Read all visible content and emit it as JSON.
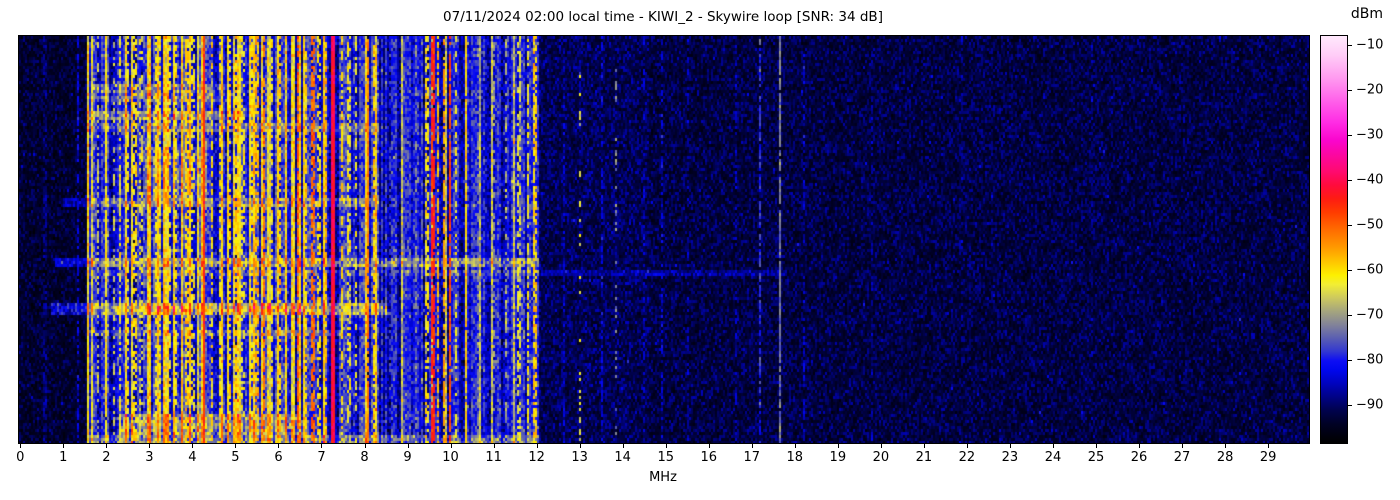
{
  "chart_data": {
    "type": "heatmap",
    "title": "07/11/2024 02:00 local time - KIWI_2 - Skywire loop [SNR: 34 dB]",
    "xlabel": "MHz",
    "x_range": [
      -0.03,
      29.95
    ],
    "x_ticks": [
      0,
      1,
      2,
      3,
      4,
      5,
      6,
      7,
      8,
      9,
      10,
      11,
      12,
      13,
      14,
      15,
      16,
      17,
      18,
      19,
      20,
      21,
      22,
      23,
      24,
      25,
      26,
      27,
      28,
      29
    ],
    "grid": false,
    "colorbar": {
      "label": "dBm",
      "vmin": -98.3,
      "vmax": -7.8,
      "ticks": [
        {
          "v": -10,
          "label": "−10"
        },
        {
          "v": -20,
          "label": "−20"
        },
        {
          "v": -30,
          "label": "−30"
        },
        {
          "v": -40,
          "label": "−40"
        },
        {
          "v": -50,
          "label": "−50"
        },
        {
          "v": -60,
          "label": "−60"
        },
        {
          "v": -70,
          "label": "−70"
        },
        {
          "v": -80,
          "label": "−80"
        },
        {
          "v": -90,
          "label": "−90"
        }
      ],
      "stops": [
        [
          -98.3,
          "#000000"
        ],
        [
          -97,
          "#00000a"
        ],
        [
          -94,
          "#000125"
        ],
        [
          -91,
          "#00024e"
        ],
        [
          -88,
          "#000287"
        ],
        [
          -85,
          "#0003bf"
        ],
        [
          -82,
          "#0007ee"
        ],
        [
          -80,
          "#0d0ef4"
        ],
        [
          -78,
          "#3136d2"
        ],
        [
          -75,
          "#5a5eb2"
        ],
        [
          -72,
          "#828399"
        ],
        [
          -69,
          "#a5a57e"
        ],
        [
          -66,
          "#cdc95e"
        ],
        [
          -63,
          "#f2ee33"
        ],
        [
          -61,
          "#fdf000"
        ],
        [
          -58,
          "#ffc600"
        ],
        [
          -55,
          "#ff9c00"
        ],
        [
          -51,
          "#ff6d00"
        ],
        [
          -47,
          "#ff3c00"
        ],
        [
          -44,
          "#fe1c12"
        ],
        [
          -41,
          "#ff0b3c"
        ],
        [
          -38,
          "#ff0a6e"
        ],
        [
          -34,
          "#fb07a4"
        ],
        [
          -31,
          "#fa05cd"
        ],
        [
          -27,
          "#ff2ce4"
        ],
        [
          -22,
          "#ff63ea"
        ],
        [
          -17,
          "#ff9cf0"
        ],
        [
          -12,
          "#ffcdf7"
        ],
        [
          -7.8,
          "#ffe9fc"
        ]
      ]
    },
    "noise_model": {
      "seed": 1234,
      "sigma": 3.4,
      "quiet_left": {
        "f0": -0.1,
        "f1": 1.55,
        "base": -95.2,
        "spark": 6.5
      },
      "quiet_mid": {
        "f0": 12.05,
        "f1": 14.6,
        "base": -93.4,
        "spark": 8.0
      },
      "quiet_right": {
        "f0": 14.6,
        "f1": 30.0,
        "base": -94.3,
        "spark": 7.5
      },
      "active_low": {
        "f0": 1.55,
        "f1": 8.35
      },
      "active_high": {
        "f0": 8.35,
        "f1": 12.05
      },
      "active_core": {
        "f0": 2.25,
        "f1": 6.7,
        "p_yellow": 0.3,
        "p_blue": 0.32
      },
      "active_edge": {
        "p_yellow": 0.12,
        "p_blue": 0.42
      },
      "active_high_p": {
        "p_yellow": 0.06,
        "p_blue": 0.58
      }
    },
    "signals": [
      [
        0.57,
        0.06,
        -88,
        0.5
      ],
      [
        1.36,
        0.05,
        -83,
        0.6
      ],
      [
        1.62,
        0.05,
        -80,
        0.6
      ],
      [
        1.8,
        0.06,
        -66,
        0.45
      ],
      [
        2.0,
        0.05,
        -61,
        0.95
      ],
      [
        2.17,
        0.05,
        -66,
        0.4
      ],
      [
        2.32,
        0.06,
        -63,
        0.6
      ],
      [
        2.5,
        0.08,
        -62,
        0.5
      ],
      [
        2.65,
        0.08,
        -60,
        0.55
      ],
      [
        2.8,
        0.06,
        -64,
        0.45
      ],
      [
        3.0,
        0.06,
        -62,
        0.5
      ],
      [
        3.2,
        0.1,
        -61,
        0.6
      ],
      [
        3.33,
        0.07,
        -58,
        0.55
      ],
      [
        3.48,
        0.06,
        -63,
        0.5
      ],
      [
        3.6,
        0.1,
        -61,
        0.55
      ],
      [
        3.75,
        0.06,
        -64,
        0.45
      ],
      [
        3.88,
        0.08,
        -59,
        0.6
      ],
      [
        4.02,
        0.06,
        -62,
        0.5
      ],
      [
        4.27,
        0.08,
        -46,
        1.0
      ],
      [
        4.47,
        0.06,
        -60,
        0.55
      ],
      [
        4.65,
        0.09,
        -61,
        0.55
      ],
      [
        4.85,
        0.07,
        -60,
        0.5
      ],
      [
        5.0,
        0.06,
        -58,
        0.6
      ],
      [
        5.17,
        0.06,
        -62,
        0.45
      ],
      [
        5.35,
        0.09,
        -60,
        0.55
      ],
      [
        5.5,
        0.06,
        -57,
        0.55
      ],
      [
        5.65,
        0.05,
        -52,
        0.65
      ],
      [
        5.85,
        0.08,
        -61,
        0.5
      ],
      [
        6.0,
        0.09,
        -59,
        0.6
      ],
      [
        6.18,
        0.07,
        -62,
        0.5
      ],
      [
        6.45,
        0.05,
        -50,
        0.75
      ],
      [
        6.6,
        0.08,
        -59,
        0.55
      ],
      [
        6.8,
        0.06,
        -51,
        0.7
      ],
      [
        6.95,
        0.07,
        -61,
        0.5
      ],
      [
        7.1,
        0.07,
        -57,
        0.6
      ],
      [
        7.25,
        0.09,
        -41,
        1.0
      ],
      [
        7.48,
        0.08,
        -59,
        0.6
      ],
      [
        7.62,
        0.09,
        -62,
        0.5
      ],
      [
        7.8,
        0.06,
        -63,
        0.45
      ],
      [
        8.08,
        0.05,
        -53,
        0.9
      ],
      [
        8.22,
        0.07,
        -59,
        0.6
      ],
      [
        8.6,
        0.05,
        -78,
        0.5
      ],
      [
        8.9,
        0.05,
        -76,
        0.5
      ],
      [
        9.2,
        0.05,
        -72,
        0.4
      ],
      [
        9.45,
        0.08,
        -61,
        0.6
      ],
      [
        9.58,
        0.07,
        -45,
        0.85
      ],
      [
        9.72,
        0.06,
        -57,
        0.7
      ],
      [
        9.85,
        0.08,
        -55,
        0.7
      ],
      [
        9.97,
        0.05,
        -48,
        0.8
      ],
      [
        10.12,
        0.05,
        -62,
        0.5
      ],
      [
        10.37,
        0.05,
        -59,
        0.95
      ],
      [
        10.65,
        0.05,
        -72,
        0.5
      ],
      [
        11.0,
        0.05,
        -70,
        0.45
      ],
      [
        11.3,
        0.06,
        -68,
        0.5
      ],
      [
        11.6,
        0.08,
        -64,
        0.55
      ],
      [
        11.8,
        0.09,
        -62,
        0.6
      ],
      [
        11.96,
        0.07,
        -59,
        0.6
      ],
      [
        12.65,
        0.05,
        -84,
        0.5
      ],
      [
        13.0,
        0.05,
        -64,
        0.22
      ],
      [
        13.5,
        0.05,
        -83,
        0.5
      ],
      [
        13.85,
        0.05,
        -72,
        0.25
      ],
      [
        14.5,
        0.04,
        -84,
        0.4
      ],
      [
        14.9,
        0.04,
        -83,
        0.4
      ],
      [
        15.5,
        0.04,
        -86,
        0.4
      ],
      [
        16.65,
        0.04,
        -85,
        0.4
      ],
      [
        17.2,
        0.06,
        -78,
        0.7
      ],
      [
        17.66,
        0.04,
        -73,
        0.9
      ],
      [
        18.2,
        0.04,
        -84,
        0.5
      ],
      [
        19.8,
        0.04,
        -87,
        0.35
      ],
      [
        21.9,
        0.04,
        -87,
        0.3
      ],
      [
        24.9,
        0.04,
        -88,
        0.3
      ]
    ],
    "streaks": [
      [
        1.7,
        4.8,
        0.12,
        0.165,
        6
      ],
      [
        1.55,
        5.2,
        0.185,
        0.205,
        9
      ],
      [
        1.55,
        8.35,
        0.215,
        0.235,
        7
      ],
      [
        2.9,
        4.35,
        0.27,
        0.4,
        6
      ],
      [
        1.0,
        8.35,
        0.4,
        0.42,
        8
      ],
      [
        0.8,
        12.05,
        0.545,
        0.565,
        10
      ],
      [
        1.5,
        17.8,
        0.575,
        0.59,
        5
      ],
      [
        0.7,
        8.5,
        0.655,
        0.685,
        12
      ],
      [
        2.2,
        6.6,
        0.66,
        0.677,
        6
      ],
      [
        1.5,
        7.5,
        0.72,
        0.735,
        6
      ],
      [
        2.3,
        6.6,
        0.93,
        0.975,
        10
      ],
      [
        1.6,
        12.05,
        0.975,
        1.0,
        8
      ]
    ]
  }
}
